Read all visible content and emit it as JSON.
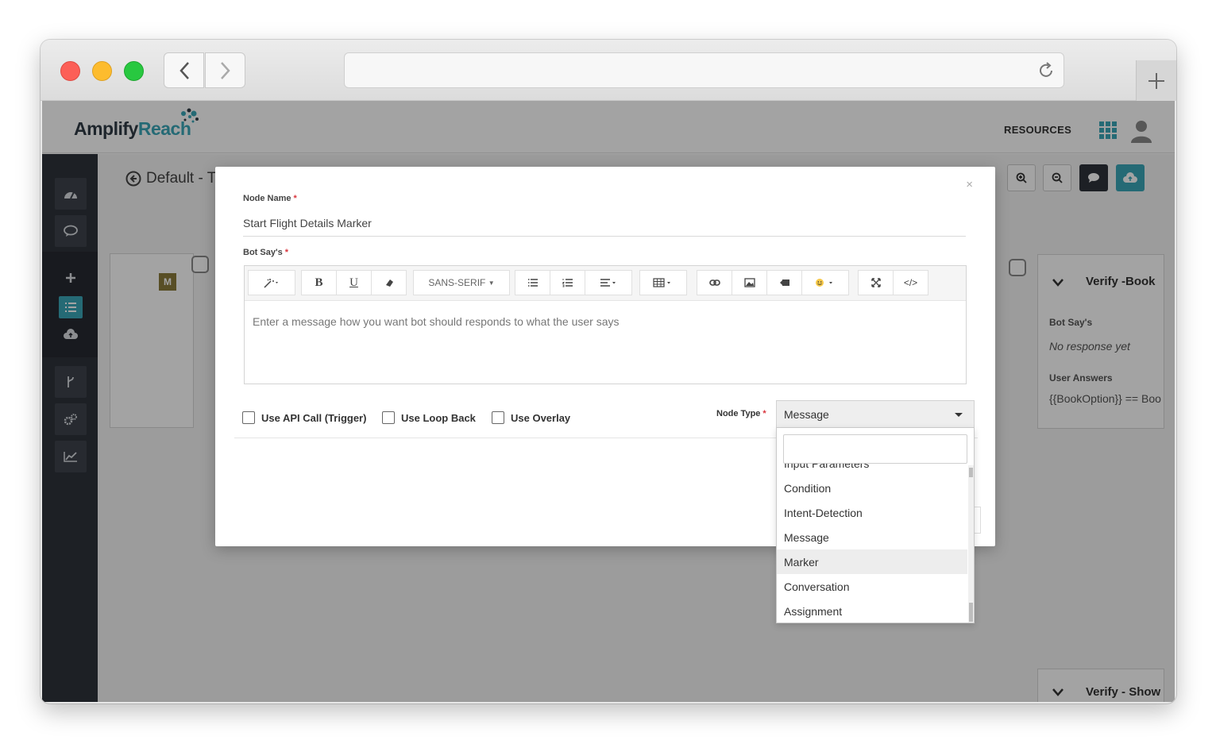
{
  "browser": {
    "url": "",
    "new_tab_label": "+"
  },
  "app": {
    "logo_part1": "Amplify",
    "logo_part2": "Reach",
    "nav_resources": "RESOURCES",
    "accent_color": "#3aa7b8"
  },
  "workspace": {
    "breadcrumb": "Default - Tr",
    "left_node_badge": "M",
    "right_node": {
      "title": "Verify -Book",
      "bot_says_label": "Bot Say's",
      "bot_says_value": "No response yet",
      "user_answers_label": "User Answers",
      "user_answers_value": "{{BookOption}} == Boo"
    },
    "right_node2_title": "Verify - Show"
  },
  "modal": {
    "close_label": "×",
    "node_name_label": "Node Name",
    "required_mark": "*",
    "node_name_value": "Start Flight Details Marker",
    "bot_says_label": "Bot Say's",
    "editor": {
      "font_label": "SANS-SERIF",
      "placeholder": "Enter a message how you want bot should responds to what the user says",
      "code_label": "</>"
    },
    "checkboxes": [
      {
        "label": "Use API Call (Trigger)",
        "checked": false
      },
      {
        "label": "Use Loop Back",
        "checked": false
      },
      {
        "label": "Use Overlay",
        "checked": false
      }
    ],
    "node_type_label": "Node Type",
    "node_type_value": "Message",
    "dropdown": {
      "search_value": "",
      "partial_item": "Input Parameters",
      "options": [
        "Condition",
        "Intent-Detection",
        "Message",
        "Marker",
        "Conversation",
        "Assignment"
      ],
      "highlighted": "Marker"
    }
  }
}
